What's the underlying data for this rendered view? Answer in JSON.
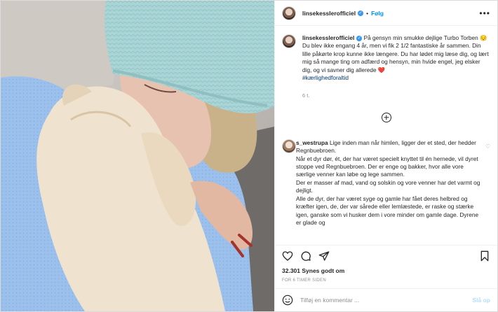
{
  "header": {
    "username": "linsekesslerofficiel",
    "verified_icon": "verified-badge-icon",
    "separator": "•",
    "follow_label": "Følg",
    "more_icon": "more-options-icon"
  },
  "caption": {
    "username": "linsekesslerofficiel",
    "line1": "På gensyn min smukke dejlige Turbo Torben 😔",
    "line2": "Du blev ikke engang 4 år, men vi fik 2 1/2 fantastiske år sammen. Din lille påkørte krop kunne ikke længere. Du har lødet mig læse dig, og lært mig så mange ting om adfærd og hensyn, min hvide engel, jeg elsker dig, og vi savner dig allerede ❤️",
    "hashtag": "#kærlighedforaltid",
    "time": "6 t."
  },
  "load_more_icon": "plus-circle-icon",
  "comment": {
    "username": "s_westrupa",
    "p1": "Lige inden man når himlen, ligger der et sted, der hedder Regnbuebroen.",
    "p2": "Når et dyr dør, ét, der har været specielt knyttet til én hernede, vil dyret stoppe ved Regnbuebroen. Der er enge og bakker, hvor alle vore særlige venner kan løbe og lege sammen.",
    "p3": "Der er masser af mad, vand og solskin og vore venner har det varmt og dejligt.",
    "p4": "Alle de dyr, der har været syge og gamle har fået deres helbred og kræfter igen, de, der var sårede eller lemlæstede, er raske og stærke igen, ganske som vi husker dem i vore minder om gamle dage. Dyrene er glade og"
  },
  "actions": {
    "like_icon": "heart-icon",
    "comment_icon": "comment-icon",
    "share_icon": "share-icon",
    "save_icon": "bookmark-icon"
  },
  "likes": "32.301 Synes godt om",
  "posted_ago": "FOR 6 TIMER SIDEN",
  "add_comment": {
    "emoji_icon": "emoji-icon",
    "placeholder": "Tilføj en kommentar ...",
    "post_label": "Slå op"
  },
  "colors": {
    "accent": "#0095f6",
    "verified": "#3897f0",
    "post_disabled": "#b2dffc",
    "hashtag": "#00376b",
    "muted": "#8e8e8e"
  }
}
